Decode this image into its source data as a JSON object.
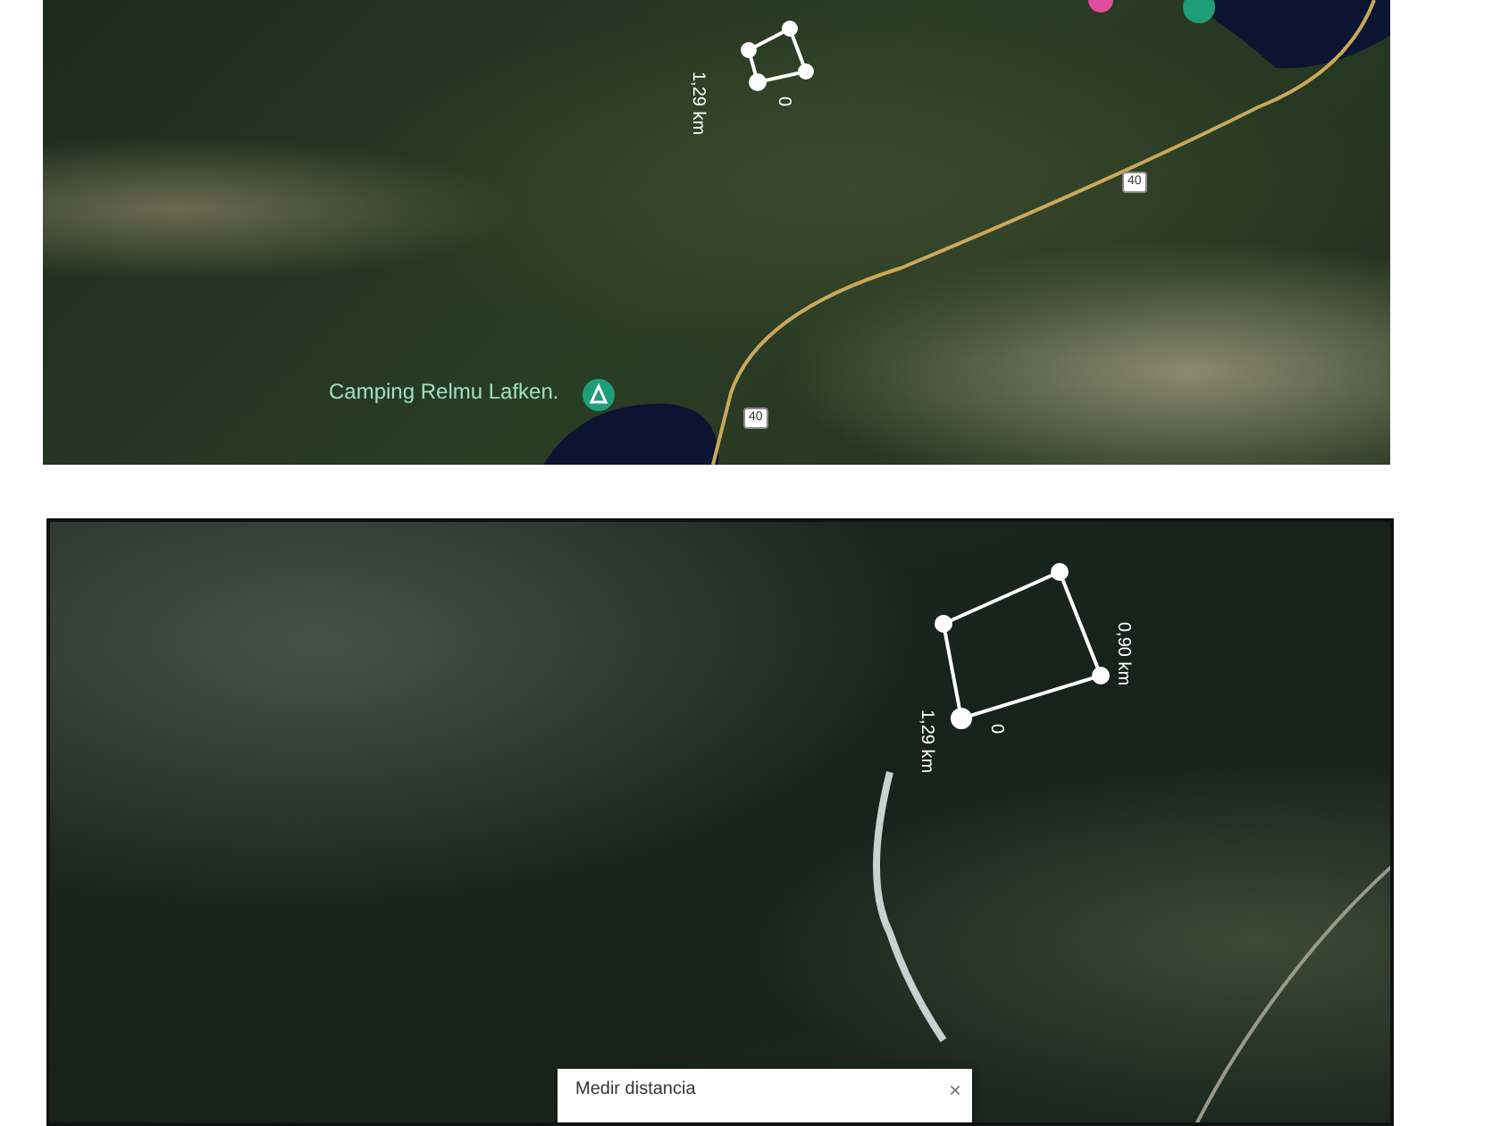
{
  "maps": [
    {
      "labels": [
        {
          "kind": "place",
          "text": "Camping Relmu Lafken."
        },
        {
          "kind": "distance",
          "text": "1,29 km"
        },
        {
          "kind": "point",
          "text": "0"
        }
      ],
      "shields": [
        "40",
        "40"
      ]
    },
    {
      "labels": [
        {
          "kind": "distance",
          "text": "0,90 km"
        },
        {
          "kind": "distance",
          "text": "1,29 km"
        },
        {
          "kind": "point",
          "text": "0"
        }
      ],
      "dialog": {
        "title": "Medir distancia",
        "close": "×"
      }
    }
  ]
}
